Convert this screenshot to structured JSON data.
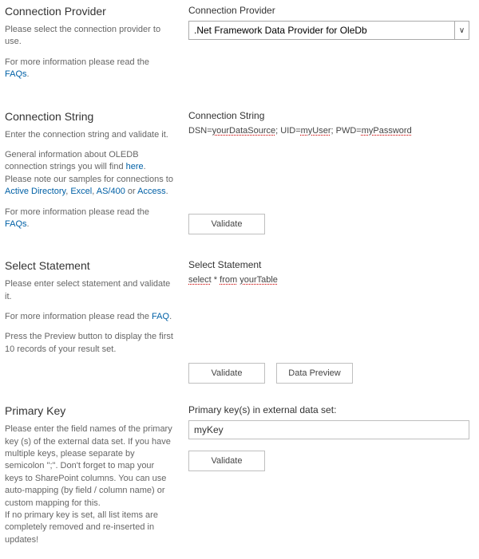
{
  "cp": {
    "heading": "Connection Provider",
    "desc": "Please select the connection provider to use.",
    "more": "For more information please read the ",
    "faqs": "FAQs",
    "label": "Connection Provider",
    "value": ".Net Framework Data Provider for OleDb"
  },
  "cs": {
    "heading": "Connection String",
    "desc": "Enter the connection string and validate it.",
    "gen1": "General information about OLEDB connection strings you will find ",
    "here": "here",
    "gen2": ". Please note our samples for connections to ",
    "ad": "Active Directory",
    "comma": ", ",
    "excel": "Excel",
    "comma2": ", ",
    "as400": "AS/400",
    "or": " or ",
    "access": "Access",
    "dot": ".",
    "more": "For more information please read the ",
    "faqs": "FAQs",
    "label": "Connection String",
    "val_a": "DSN=",
    "val_b": "yourDataSource",
    "val_c": ";  UID=",
    "val_d": "myUser",
    "val_e": "; PWD=",
    "val_f": "myPassword",
    "validate": "Validate"
  },
  "ss": {
    "heading": "Select Statement",
    "desc": "Please enter select statement and validate it.",
    "more": "For more information please read the ",
    "faq": "FAQ",
    "press": "Press the Preview button to display the first 10 records of your result set.",
    "label": "Select Statement",
    "val_a": "select",
    "val_b": " * ",
    "val_c": "from",
    "val_d": " ",
    "val_e": "yourTable",
    "validate": "Validate",
    "preview": "Data Preview"
  },
  "pk": {
    "heading": "Primary Key",
    "desc": "Please enter the field names of the primary key (s) of the external data set. If you have multiple keys, please separate by semicolon \";\". Don't forget to map your keys to SharePoint columns. You can use auto-mapping (by field / column name) or custom mapping for this.",
    "desc2": "If no primary key is set, all list items are completely removed and re-inserted in updates!",
    "label": "Primary key(s) in external data set:",
    "value": "myKey",
    "validate": "Validate"
  }
}
